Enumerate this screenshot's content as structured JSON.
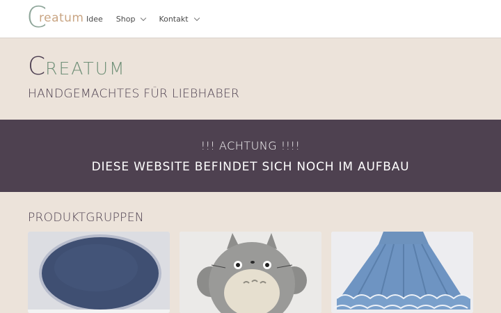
{
  "nav": {
    "logo_letter": "C",
    "logo_rest": "reatum",
    "items": [
      {
        "label": "Idee",
        "has_dropdown": false,
        "icon": ""
      },
      {
        "label": "Shop",
        "has_dropdown": true,
        "icon": "chevron-down-icon"
      },
      {
        "label": "Kontakt",
        "has_dropdown": true,
        "icon": "chevron-down-icon"
      }
    ]
  },
  "hero": {
    "brand_letter": "C",
    "brand_rest": "REATUM",
    "tagline": "HANDGEMACHTES FÜR LIEBHABER"
  },
  "banner": {
    "line1": "!!! ACHTUNG !!!!",
    "line2": "DIESE WEBSITE BEFINDET SICH NOCH IM AUFBAU"
  },
  "products": {
    "title": "PRODUKTGRUPPEN",
    "cards": [
      {
        "image": "blue-crocheted-round-placemat"
      },
      {
        "image": "crocheted-totoro-plush"
      },
      {
        "image": "blue-crocheted-ruffled-skirt"
      }
    ]
  },
  "colors": {
    "background": "#ece3da",
    "banner": "#4e4150",
    "brand_green": "#6f8f77",
    "brand_purple": "#4d3f51",
    "logo_tan": "#c9a583"
  }
}
